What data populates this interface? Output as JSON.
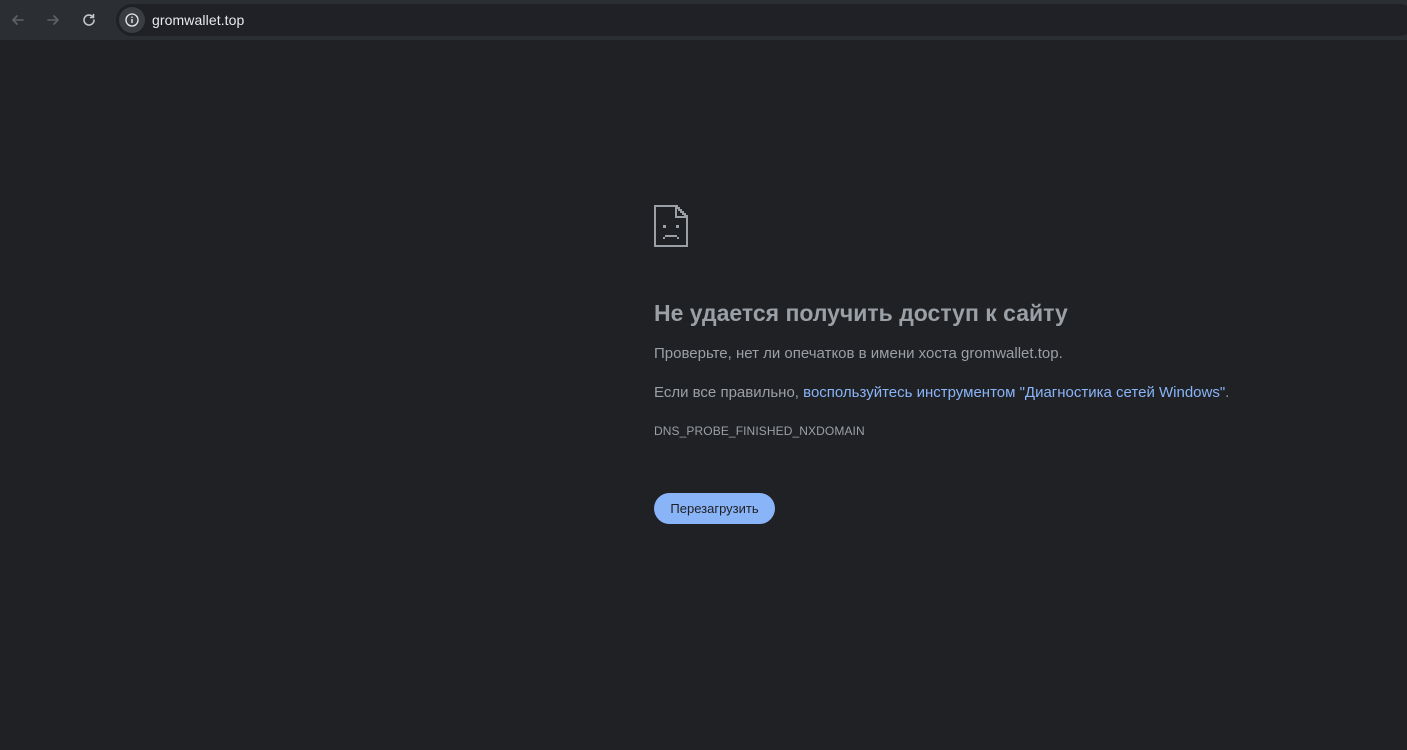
{
  "browser": {
    "url": "gromwallet.top",
    "back_icon": "arrow-left-icon",
    "forward_icon": "arrow-right-icon",
    "reload_icon": "reload-icon",
    "site_info_icon": "info-icon"
  },
  "error_page": {
    "icon": "sad-document-icon",
    "headline": "Не удается получить доступ к сайту",
    "check_text": "Проверьте, нет ли опечатков в имени хоста gromwallet.top.",
    "if_correct_prefix": "Если все правильно, ",
    "diagnostics_link": "воспользуйтесь инструментом \"Диагностика сетей Windows\"",
    "if_correct_suffix": ".",
    "error_code": "DNS_PROBE_FINISHED_NXDOMAIN",
    "reload_button": "Перезагрузить"
  },
  "colors": {
    "background": "#202124",
    "text": "#9aa0a6",
    "link": "#8ab4f8",
    "button_bg": "#8ab4f8"
  }
}
